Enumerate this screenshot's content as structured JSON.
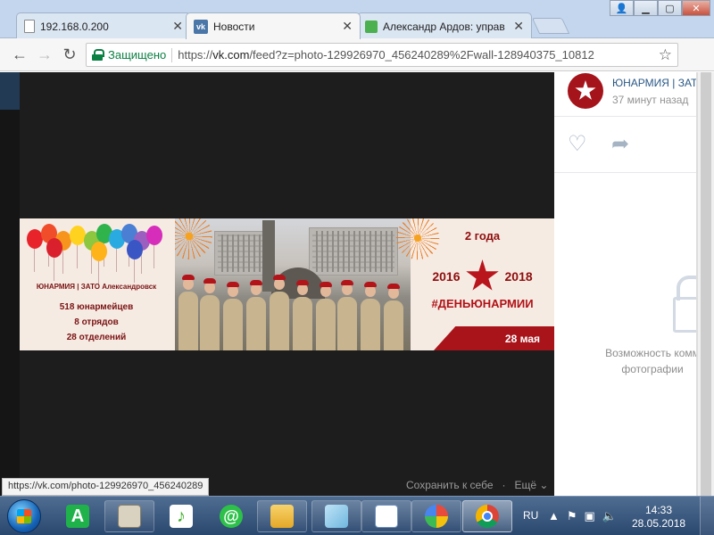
{
  "browser": {
    "tabs": [
      {
        "title": "192.168.0.200",
        "icon": "document-icon"
      },
      {
        "title": "Новости",
        "icon": "vk-icon"
      },
      {
        "title": "Александр Ардов: управ",
        "icon": "green-square-icon"
      }
    ],
    "vk_favicon_text": "vk",
    "secure_label": "Защищено",
    "url_scheme": "https://",
    "url_domain": "vk.com",
    "url_path": "/feed?z=photo-129926970_456240289%2Fwall-128940375_10812",
    "status_url": "https://vk.com/photo-129926970_456240289"
  },
  "viewer": {
    "save_label": "Сохранить к себе",
    "more_label": "Ещё",
    "banner": {
      "left": {
        "org": "ЮНАРМИЯ | ЗАТО Александровск",
        "stats": [
          "518 юнармейцев",
          "8 отрядов",
          "28 отделений"
        ]
      },
      "right": {
        "years": "2 года",
        "start_year": "2016",
        "end_year": "2018",
        "hashtag": "#ДЕНЬЮНАРМИИ",
        "date": "28 мая"
      }
    }
  },
  "sidebar": {
    "author": "ЮНАРМИЯ | ЗАТО",
    "time": "37 минут назад",
    "restricted_line1": "Возможность комм",
    "restricted_line2": "фотографии"
  },
  "taskbar": {
    "apps": [
      "app-a-icon",
      "newspaper-icon",
      "music-icon",
      "mail-at-icon",
      "folder-icon",
      "notepad-icon",
      "wordpad-icon",
      "paint-icon",
      "chrome-icon"
    ],
    "app_a_text": "A",
    "mail_at_text": "@",
    "music_text": "♪",
    "language": "RU",
    "time": "14:33",
    "date": "28.05.2018"
  },
  "colors": {
    "vk_blue": "#4a76a8",
    "secure_green": "#0b8043",
    "brand_red": "#a8141a"
  }
}
